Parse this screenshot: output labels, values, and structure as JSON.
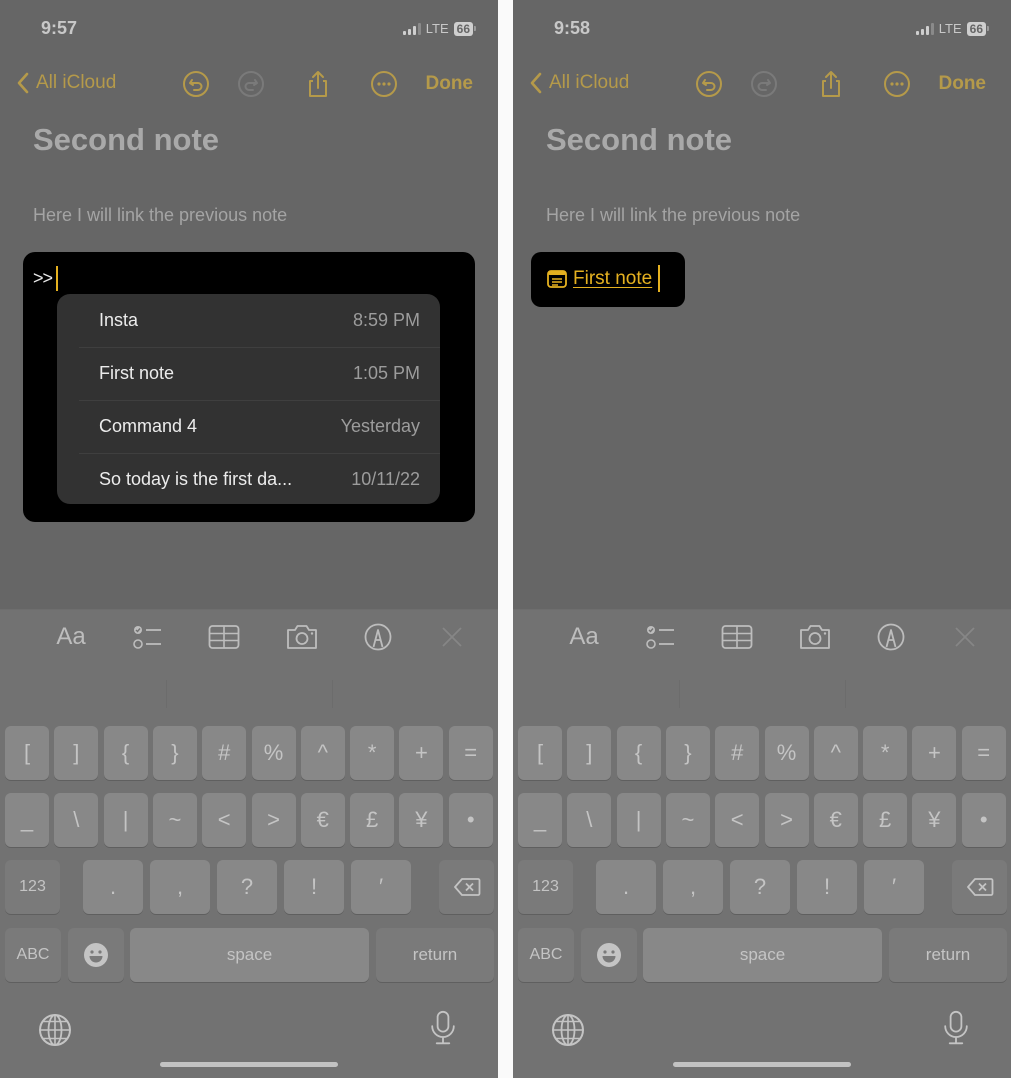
{
  "panels": [
    {
      "status": {
        "time": "9:57",
        "network": "LTE",
        "battery": "66"
      },
      "nav": {
        "back_label": "All iCloud",
        "done_label": "Done"
      },
      "note": {
        "title": "Second note",
        "body": "Here I will link the previous note",
        "typed_text": ">>"
      },
      "link_suggestions": [
        {
          "title": "Insta",
          "date": "8:59 PM"
        },
        {
          "title": "First note",
          "date": "1:05 PM"
        },
        {
          "title": "Command 4",
          "date": "Yesterday"
        },
        {
          "title": "So today is the first da...",
          "date": "10/11/22"
        }
      ]
    },
    {
      "status": {
        "time": "9:58",
        "network": "LTE",
        "battery": "66"
      },
      "nav": {
        "back_label": "All iCloud",
        "done_label": "Done"
      },
      "note": {
        "title": "Second note",
        "body": "Here I will link the previous note",
        "link_text": "First note"
      }
    }
  ],
  "toolbar": {
    "format_label": "Aa"
  },
  "keyboard": {
    "row1": [
      "[",
      "]",
      "{",
      "}",
      "#",
      "%",
      "^",
      "*",
      "+",
      "="
    ],
    "row2": [
      "_",
      "\\",
      "|",
      "~",
      "<",
      ">",
      "€",
      "£",
      "¥",
      "•"
    ],
    "row3_mode": "123",
    "row3": [
      ".",
      ",",
      "?",
      "!",
      "′"
    ],
    "row4_mode": "ABC",
    "space_label": "space",
    "return_label": "return"
  },
  "colors": {
    "accent": "#e5b120",
    "dimmed_accent": "#b59a4a",
    "background": "#666666"
  }
}
